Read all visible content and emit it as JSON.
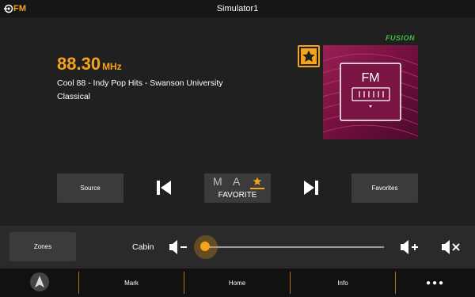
{
  "titlebar": {
    "source_label": "FM",
    "title": "Simulator1"
  },
  "radio": {
    "frequency": "88.30",
    "unit": "MHz",
    "station": "Cool 88 - Indy Pop Hits - Swanson University",
    "genre": "Classical",
    "brand_logo": "FUSION",
    "album_art_label": "FM"
  },
  "controls": {
    "source_label": "Source",
    "favorites_label": "Favorites",
    "favorite": {
      "mode_m": "M",
      "mode_a": "A",
      "label": "FAVORITE"
    }
  },
  "zone": {
    "zones_label": "Zones",
    "name": "Cabin",
    "volume_level": 0.0
  },
  "nav": {
    "items": [
      {
        "label": "Mark"
      },
      {
        "label": "Home"
      },
      {
        "label": "Info"
      }
    ],
    "more_label": "●●●"
  },
  "colors": {
    "accent": "#f5a31a",
    "background": "#202020",
    "button": "#3b3b3b",
    "brand_green": "#3fbf3f",
    "album": "#9a1f55"
  },
  "icons": [
    "radio-source-icon",
    "star-icon",
    "previous-track-icon",
    "next-track-icon",
    "volume-down-icon",
    "volume-up-icon",
    "mute-icon",
    "compass-icon"
  ]
}
